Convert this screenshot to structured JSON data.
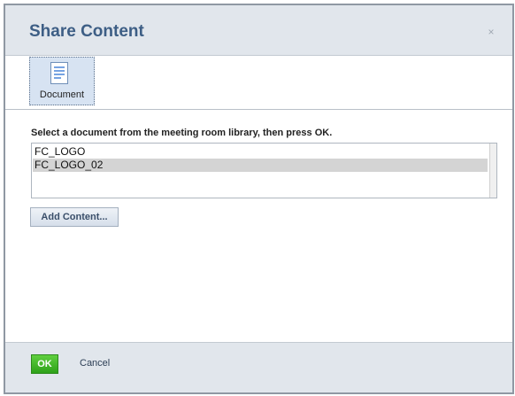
{
  "dialog": {
    "title": "Share Content",
    "close_glyph": "×"
  },
  "toolbar": {
    "document_label": "Document",
    "document_icon": "document-icon"
  },
  "content": {
    "instruction": "Select a document from the meeting room library, then press OK.",
    "library_items": [
      {
        "label": "FC_LOGO",
        "selected": false
      },
      {
        "label": "FC_LOGO_02",
        "selected": true
      }
    ],
    "add_content_label": "Add Content..."
  },
  "footer": {
    "ok_label": "OK",
    "cancel_label": "Cancel"
  },
  "colors": {
    "title": "#3d5e85",
    "header_bg": "#e1e6ec",
    "ok_green": "#2ea11a",
    "selection": "#d4d4d4"
  }
}
